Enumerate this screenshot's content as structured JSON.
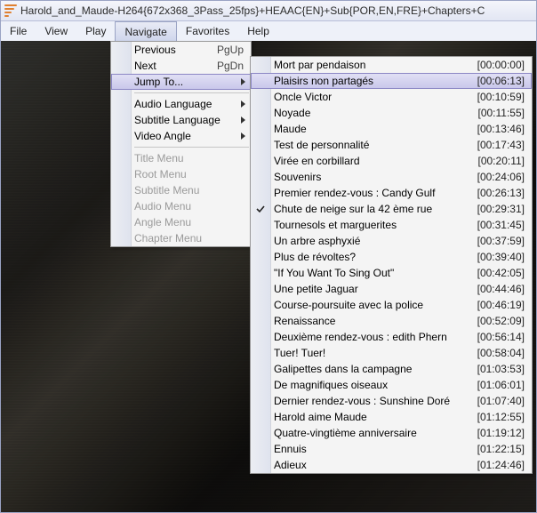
{
  "window": {
    "title": "Harold_and_Maude-H264{672x368_3Pass_25fps}+HEAAC{EN}+Sub{POR,EN,FRE}+Chapters+C"
  },
  "menubar": {
    "file": "File",
    "view": "View",
    "play": "Play",
    "navigate": "Navigate",
    "favorites": "Favorites",
    "help": "Help"
  },
  "nav_menu": {
    "previous": "Previous",
    "previous_accel": "PgUp",
    "next": "Next",
    "next_accel": "PgDn",
    "jump_to": "Jump To...",
    "audio_lang": "Audio Language",
    "subtitle_lang": "Subtitle Language",
    "video_angle": "Video Angle",
    "title_menu": "Title Menu",
    "root_menu": "Root Menu",
    "subtitle_menu": "Subtitle Menu",
    "audio_menu": "Audio Menu",
    "angle_menu": "Angle Menu",
    "chapter_menu": "Chapter Menu"
  },
  "chapters": [
    {
      "label": "Mort par pendaison",
      "time": "[00:00:00]"
    },
    {
      "label": "Plaisirs non partagés",
      "time": "[00:06:13]",
      "hover": true
    },
    {
      "label": "Oncle Victor",
      "time": "[00:10:59]"
    },
    {
      "label": "Noyade",
      "time": "[00:11:55]"
    },
    {
      "label": "Maude",
      "time": "[00:13:46]"
    },
    {
      "label": "Test de personnalité",
      "time": "[00:17:43]"
    },
    {
      "label": "Virée en corbillard",
      "time": "[00:20:11]"
    },
    {
      "label": "Souvenirs",
      "time": "[00:24:06]"
    },
    {
      "label": "Premier rendez-vous : Candy Gulf",
      "time": "[00:26:13]"
    },
    {
      "label": "Chute de neige sur la 42 ème rue",
      "time": "[00:29:31]",
      "checked": true
    },
    {
      "label": "Tournesols et marguerites",
      "time": "[00:31:45]"
    },
    {
      "label": "Un arbre asphyxié",
      "time": "[00:37:59]"
    },
    {
      "label": "Plus de révoltes?",
      "time": "[00:39:40]"
    },
    {
      "label": "\"If You Want To Sing Out\"",
      "time": "[00:42:05]"
    },
    {
      "label": "Une petite Jaguar",
      "time": "[00:44:46]"
    },
    {
      "label": "Course-poursuite avec la police",
      "time": "[00:46:19]"
    },
    {
      "label": "Renaissance",
      "time": "[00:52:09]"
    },
    {
      "label": "Deuxième rendez-vous : edith Phern",
      "time": "[00:56:14]"
    },
    {
      "label": "Tuer! Tuer!",
      "time": "[00:58:04]"
    },
    {
      "label": "Galipettes dans la campagne",
      "time": "[01:03:53]"
    },
    {
      "label": "De magnifiques oiseaux",
      "time": "[01:06:01]"
    },
    {
      "label": "Dernier rendez-vous : Sunshine Doré",
      "time": "[01:07:40]"
    },
    {
      "label": "Harold aime Maude",
      "time": "[01:12:55]"
    },
    {
      "label": "Quatre-vingtième anniversaire",
      "time": "[01:19:12]"
    },
    {
      "label": "Ennuis",
      "time": "[01:22:15]"
    },
    {
      "label": "Adieux",
      "time": "[01:24:46]"
    }
  ]
}
